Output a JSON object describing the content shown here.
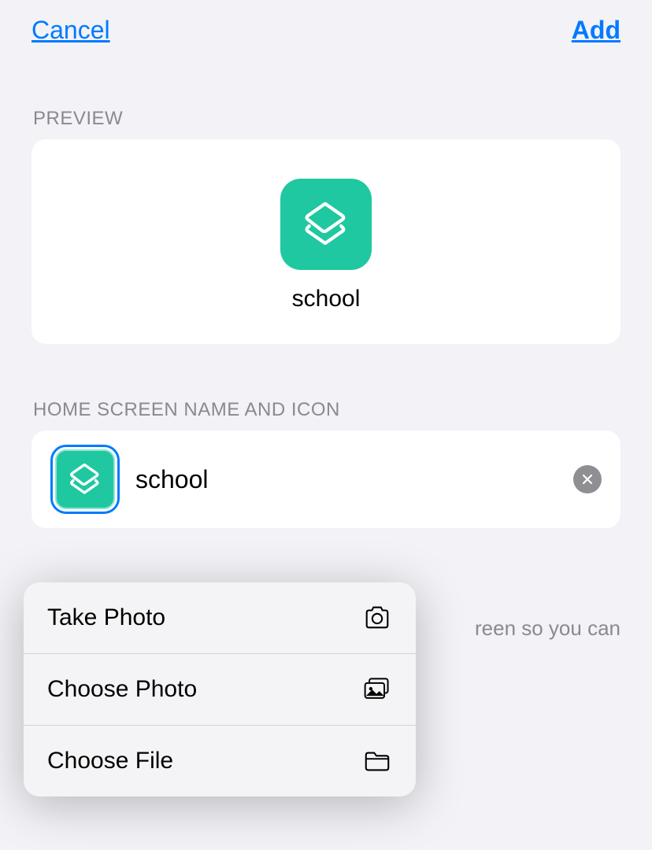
{
  "header": {
    "cancel": "Cancel",
    "add": "Add"
  },
  "sections": {
    "preview_label": "PREVIEW",
    "name_label": "HOME SCREEN NAME AND ICON"
  },
  "shortcut": {
    "name": "school",
    "icon_color": "#1fc8a0"
  },
  "menu": {
    "take_photo": "Take Photo",
    "choose_photo": "Choose Photo",
    "choose_file": "Choose File"
  },
  "footer_partial": "reen so you can"
}
